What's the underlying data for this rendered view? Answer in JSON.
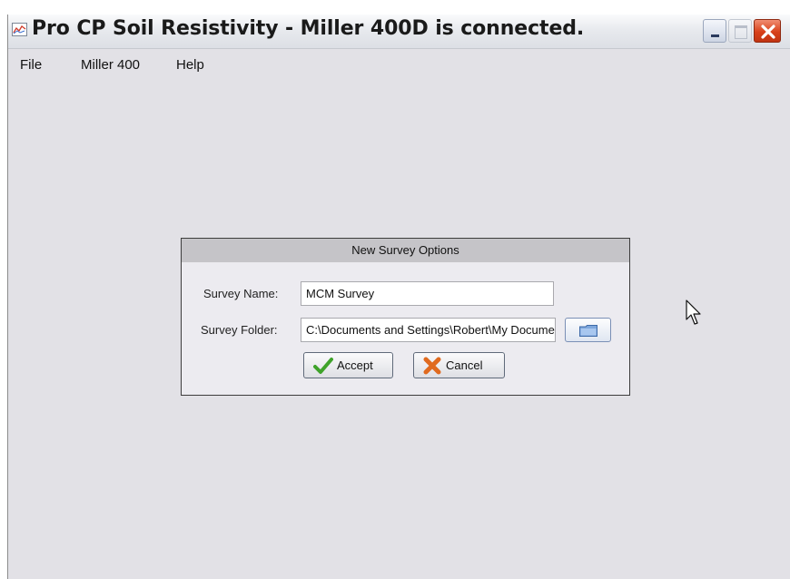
{
  "window": {
    "title": "Pro CP Soil Resistivity - Miller 400D is connected."
  },
  "menu": {
    "items": [
      "File",
      "Miller 400",
      "Help"
    ]
  },
  "dialog": {
    "title": "New Survey Options",
    "survey_name_label": "Survey Name:",
    "survey_name_value": "MCM Survey",
    "survey_folder_label": "Survey Folder:",
    "survey_folder_value": "C:\\Documents and Settings\\Robert\\My Documents",
    "accept_label": "Accept",
    "cancel_label": "Cancel"
  },
  "icons": {
    "app": "chart-icon",
    "browse": "folder-icon",
    "accept": "checkmark-icon",
    "cancel": "x-icon",
    "cursor": "mouse-pointer-icon"
  },
  "colors": {
    "close_button": "#d8411a",
    "accept_check": "#3fa32a",
    "cancel_x": "#e06a1f"
  }
}
